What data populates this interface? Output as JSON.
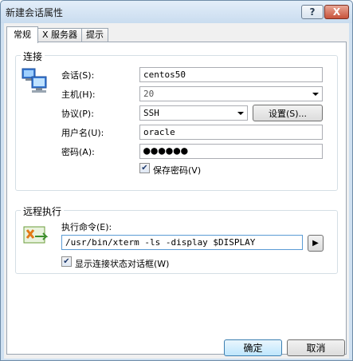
{
  "window": {
    "title": "新建会话属性",
    "help_label": "?",
    "close_label": "X"
  },
  "tabs": [
    {
      "label": "常规"
    },
    {
      "label": "X 服务器"
    },
    {
      "label": "提示"
    }
  ],
  "connection": {
    "group_label": "连接",
    "session_label": "会话(S):",
    "session_value": "centos50",
    "host_label": "主机(H):",
    "host_value": "20",
    "protocol_label": "协议(P):",
    "protocol_value": "SSH",
    "settings_button": "设置(S)...",
    "username_label": "用户名(U):",
    "username_value": "oracle",
    "password_label": "密码(A):",
    "password_value": "●●●●●●",
    "save_password_label": "保存密码(V)",
    "save_password_checked": true
  },
  "remote": {
    "group_label": "远程执行",
    "command_label": "执行命令(E):",
    "command_value": "/usr/bin/xterm -ls -display $DISPLAY",
    "run_button": "▶",
    "show_dialog_label": "显示连接状态对话框(W)",
    "show_dialog_checked": true
  },
  "footer": {
    "ok_label": "确定",
    "cancel_label": "取消"
  }
}
